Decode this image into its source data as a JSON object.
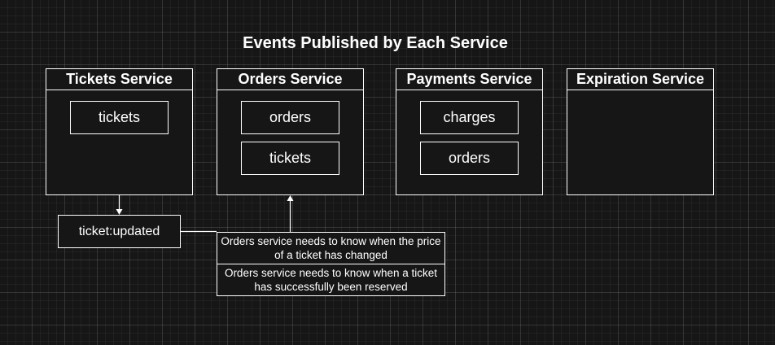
{
  "title": "Events Published by Each Service",
  "services": [
    {
      "name": "Tickets Service",
      "events": [
        "tickets"
      ]
    },
    {
      "name": "Orders Service",
      "events": [
        "orders",
        "tickets"
      ]
    },
    {
      "name": "Payments Service",
      "events": [
        "charges",
        "orders"
      ]
    },
    {
      "name": "Expiration Service",
      "events": []
    }
  ],
  "event": {
    "label": "ticket:updated"
  },
  "notes": [
    "Orders service needs to know when the price of a ticket has changed",
    "Orders service needs to know when a ticket has successfully been reserved"
  ],
  "colors": {
    "background": "#161616",
    "stroke": "#ffffff",
    "text": "#ffffff"
  }
}
